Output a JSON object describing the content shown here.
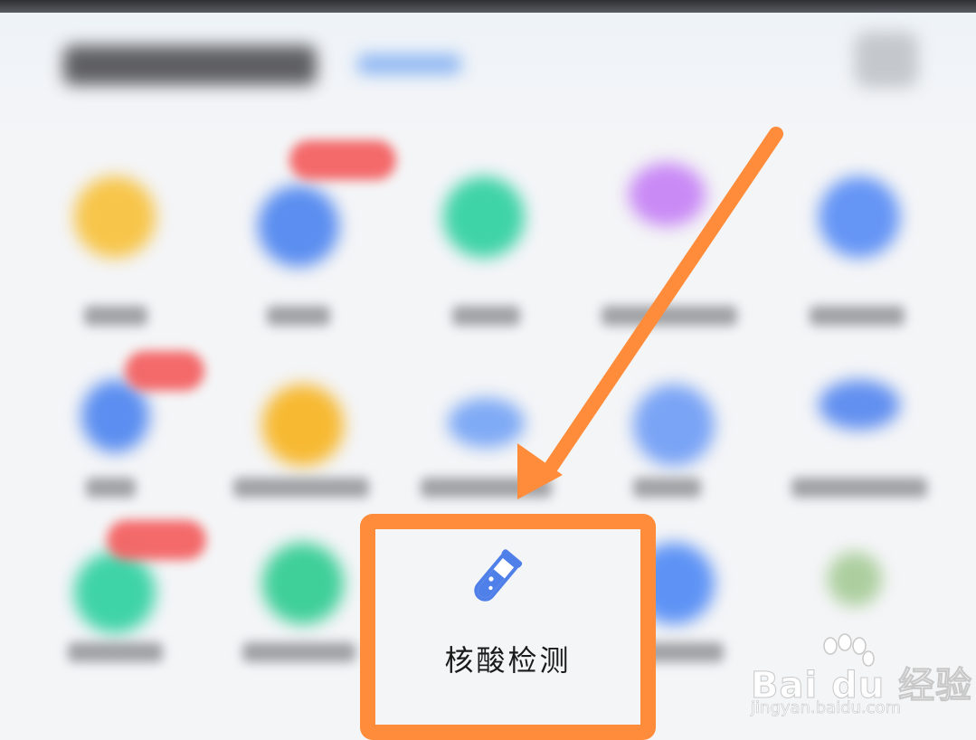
{
  "highlighted_feature": {
    "label": "核酸检测",
    "icon": "test-tube-icon"
  },
  "watermark": {
    "brand": "Bai du 经验",
    "url": "jingyan.baidu.com"
  },
  "colors": {
    "highlight_border": "#ff8c3a",
    "arrow": "#ff8c3a",
    "feature_icon": "#4f7fe8",
    "badge": "#f45b5b",
    "background": "#f4f5f7"
  },
  "grid_icons": [
    {
      "name": "yellow-app-icon",
      "color": "#f7c54a"
    },
    {
      "name": "blue-app-icon",
      "color": "#5b8ef0"
    },
    {
      "name": "green-app-icon",
      "color": "#3fd3a8"
    },
    {
      "name": "purple-app-icon",
      "color": "#c98af5"
    },
    {
      "name": "blue-app-icon",
      "color": "#6595f5"
    },
    {
      "name": "blue-app-icon",
      "color": "#5b8ef0"
    },
    {
      "name": "yellow-app-icon",
      "color": "#f7b932"
    },
    {
      "name": "lightblue-app-icon",
      "color": "#7faaf5"
    },
    {
      "name": "blue-app-icon",
      "color": "#7aa4f5"
    },
    {
      "name": "blue-app-icon",
      "color": "#6290f0"
    },
    {
      "name": "green-app-icon",
      "color": "#3fd3a8"
    },
    {
      "name": "green-app-icon",
      "color": "#3fcf99"
    },
    {
      "name": "blue-app-icon",
      "color": "#5e93f5"
    },
    {
      "name": "multicolor-app-icon",
      "color": "#8fbf7a"
    }
  ]
}
